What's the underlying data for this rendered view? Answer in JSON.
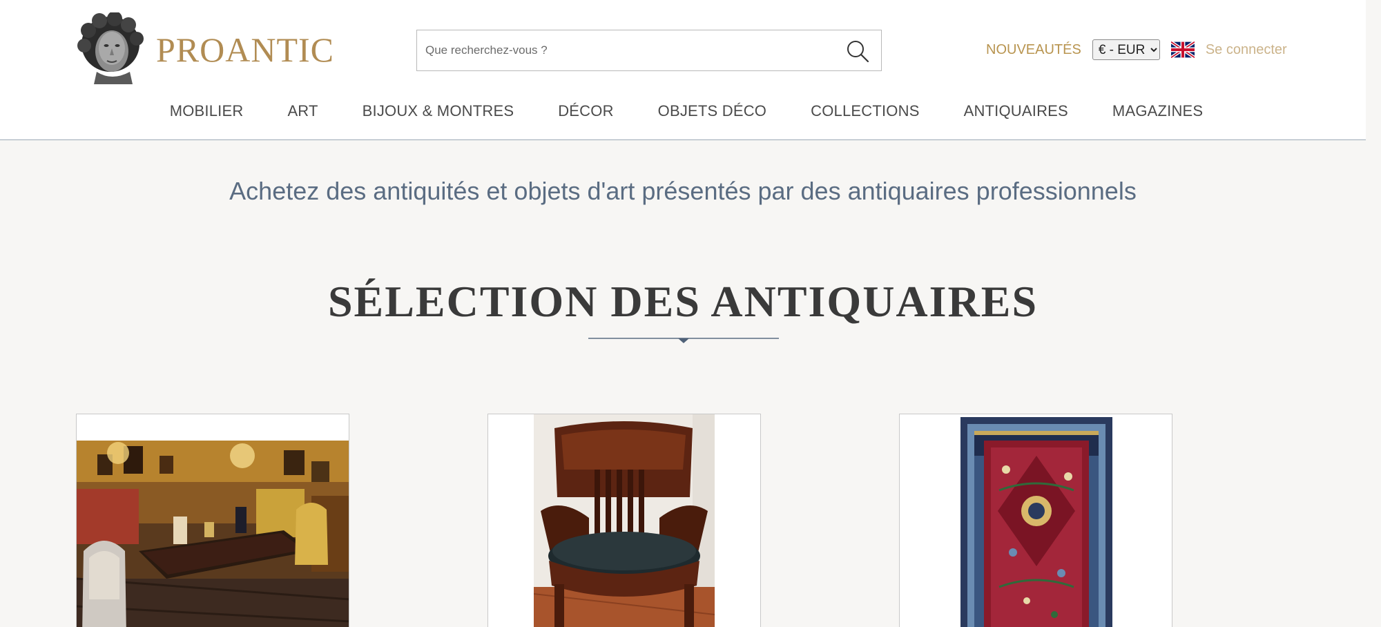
{
  "header": {
    "logo_text": "PROANTIC",
    "search": {
      "placeholder": "Que recherchez-vous ?",
      "value": ""
    },
    "nouveautes_label": "NOUVEAUTÉS",
    "currency": {
      "selected": "€ - EUR",
      "options": [
        "€ - EUR"
      ]
    },
    "language_flag": "uk-flag-icon",
    "login_label": "Se connecter",
    "colors": {
      "brand_gold": "#b18c53",
      "nav_text": "#4a4a4a"
    }
  },
  "nav": {
    "items": [
      {
        "label": "MOBILIER"
      },
      {
        "label": "ART"
      },
      {
        "label": "BIJOUX & MONTRES"
      },
      {
        "label": "DÉCOR"
      },
      {
        "label": "OBJETS DÉCO"
      },
      {
        "label": "COLLECTIONS"
      },
      {
        "label": "ANTIQUAIRES"
      },
      {
        "label": "MAGAZINES"
      }
    ]
  },
  "main": {
    "tagline": "Achetez des antiquités et objets d'art présentés par des antiquaires professionnels",
    "section_title": "SÉLECTION DES ANTIQUAIRES",
    "cards": [
      {
        "image": "antique-shop-interior-with-desk"
      },
      {
        "image": "mahogany-armchair-with-black-cushion"
      },
      {
        "image": "persian-carpet-red-and-blue"
      }
    ]
  }
}
